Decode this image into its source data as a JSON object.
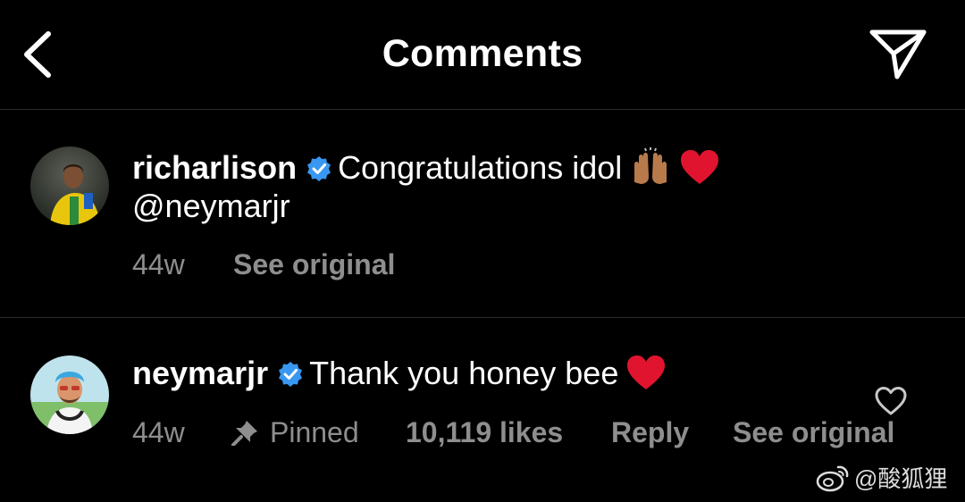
{
  "header": {
    "title": "Comments",
    "back_icon": "chevron-left-icon",
    "send_icon": "paper-plane-icon"
  },
  "comments": [
    {
      "username": "richarlison",
      "text_line1": "Congratulations idol",
      "text_line2": "@neymarjr",
      "emoji": [
        "raising-hands-emoji",
        "red-heart-emoji"
      ],
      "time": "44w",
      "see_original": "See original"
    },
    {
      "username": "neymarjr",
      "text_line1": "Thank you honey bee",
      "emoji": [
        "red-heart-emoji"
      ],
      "time": "44w",
      "pinned": "Pinned",
      "likes": "10,119 likes",
      "reply": "Reply",
      "see_original": "See original"
    }
  ],
  "watermark": "@酸狐狸",
  "colors": {
    "background": "#000000",
    "text": "#ffffff",
    "meta_text": "#8e8e8e",
    "verified_blue": "#3897f0",
    "heart_red": "#e0142e"
  }
}
